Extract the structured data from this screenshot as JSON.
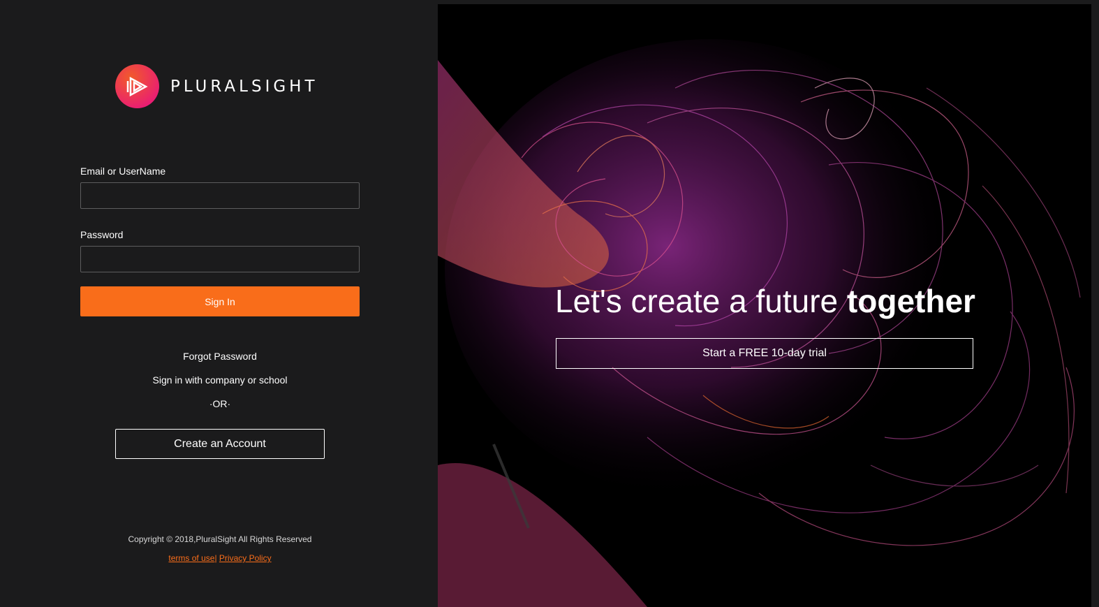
{
  "brand": {
    "name": "PLURALSIGHT",
    "logo_icon": "pluralsight-play-icon",
    "colors": {
      "orange": "#f96d1a",
      "pink": "#e80a89",
      "background": "#1b1b1c"
    }
  },
  "login_form": {
    "email_label": "Email or UserName",
    "email_value": "",
    "password_label": "Password",
    "password_value": "",
    "signin_label": "Sign In",
    "forgot_password": "Forgot Password",
    "company_signin": "Sign in with company or school",
    "or_divider": "·OR·",
    "create_account": "Create an Account"
  },
  "footer": {
    "copyright": "Copyright © 2018,PluralSight All Rights Reserved",
    "terms": "terms of use",
    "separator": "|",
    "privacy": "Privacy Policy"
  },
  "hero": {
    "headline_light": "Let's create a future ",
    "headline_bold": "together",
    "trial_button": "Start a FREE 10-day trial"
  }
}
